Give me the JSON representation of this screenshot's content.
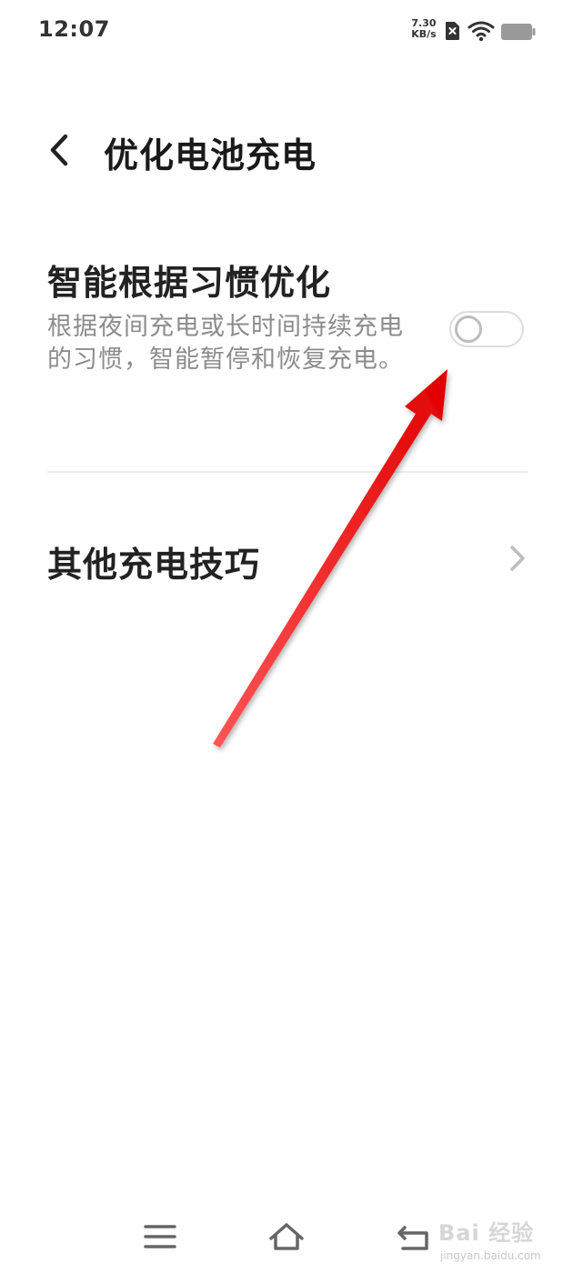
{
  "status_bar": {
    "time": "12:07",
    "net_speed_value": "7.30",
    "net_speed_unit": "KB/s",
    "icons": [
      "sim-error-icon",
      "wifi-icon",
      "battery-icon"
    ]
  },
  "header": {
    "back_icon": "chevron-left-icon",
    "title": "优化电池充电"
  },
  "smart_optimize": {
    "title": "智能根据习惯优化",
    "description": "根据夜间充电或长时间持续充电的习惯，智能暂停和恢复充电。",
    "enabled": false
  },
  "other_tips": {
    "label": "其他充电技巧",
    "icon": "chevron-right-icon"
  },
  "nav_bar": {
    "icons": [
      "menu-icon",
      "home-icon",
      "back-icon"
    ]
  },
  "watermark": {
    "main": "Bai 经验",
    "sub": "jingyan.baidu.com"
  },
  "colors": {
    "annotation_arrow": "#e00000",
    "description_text": "#8c8c8c",
    "divider": "#ececec"
  }
}
